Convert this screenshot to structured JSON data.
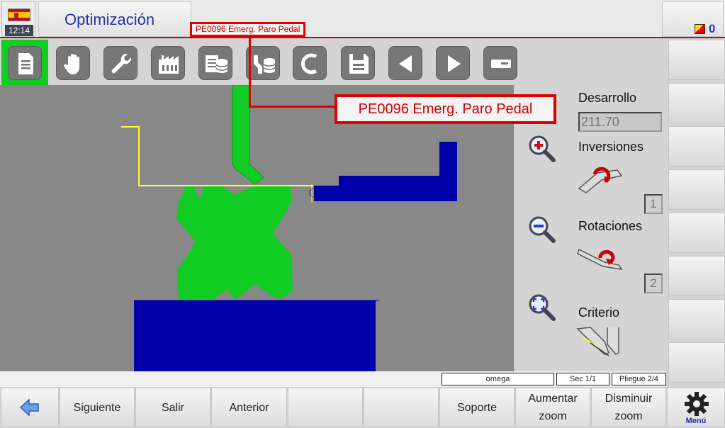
{
  "header": {
    "clock": "12:14",
    "title": "Optimización",
    "message": "PE0096 Emerg. Paro Pedal",
    "alarm_count": "0",
    "colors": {
      "title": "#2233aa",
      "alarm_border": "#e00000",
      "alarm_text": "#cc0000"
    }
  },
  "toolbar": {
    "buttons": [
      {
        "icon": "document-icon",
        "selected": true
      },
      {
        "icon": "hand-icon"
      },
      {
        "icon": "wrench-icon"
      },
      {
        "icon": "factory-icon"
      },
      {
        "icon": "database-list-icon"
      },
      {
        "icon": "tool-database-icon"
      },
      {
        "icon": "refresh-icon"
      },
      {
        "icon": "save-icon"
      },
      {
        "icon": "arrow-left-icon"
      },
      {
        "icon": "arrow-right-icon"
      },
      {
        "icon": "minus-icon"
      }
    ],
    "selected_color": "#11cc22"
  },
  "alert_popup": {
    "message": "PE0096 Emerg. Paro Pedal"
  },
  "info_panel": {
    "desarrollo_label": "Desarrollo",
    "desarrollo_value": "211.70",
    "inversiones_label": "Inversiones",
    "inversiones_value": "1",
    "rotaciones_label": "Rotaciones",
    "rotaciones_value": "2",
    "criterio_label": "Criterio",
    "zoom_in_icon": "zoom-in-icon",
    "zoom_out_icon": "zoom-out-icon",
    "zoom_fit_icon": "zoom-fit-icon"
  },
  "canvas": {
    "background": "#888888",
    "tool_color": "#11cc22",
    "die_color": "#0000aa",
    "sheet_color": "#ffff33"
  },
  "status": {
    "profile": "omega",
    "sec": "Sec  1/1",
    "pliegue": "Pliegue 2/4"
  },
  "bottom_bar": {
    "back_icon": "arrow-left-icon",
    "siguiente": "Siguiente",
    "salir": "Salir",
    "anterior": "Anterior",
    "empty1": "",
    "empty2": "",
    "soporte": "Soporte",
    "aumentar_zoom": "Aumentar zoom",
    "disminuir_zoom": "Disminuir zoom",
    "menu": "Menú"
  }
}
